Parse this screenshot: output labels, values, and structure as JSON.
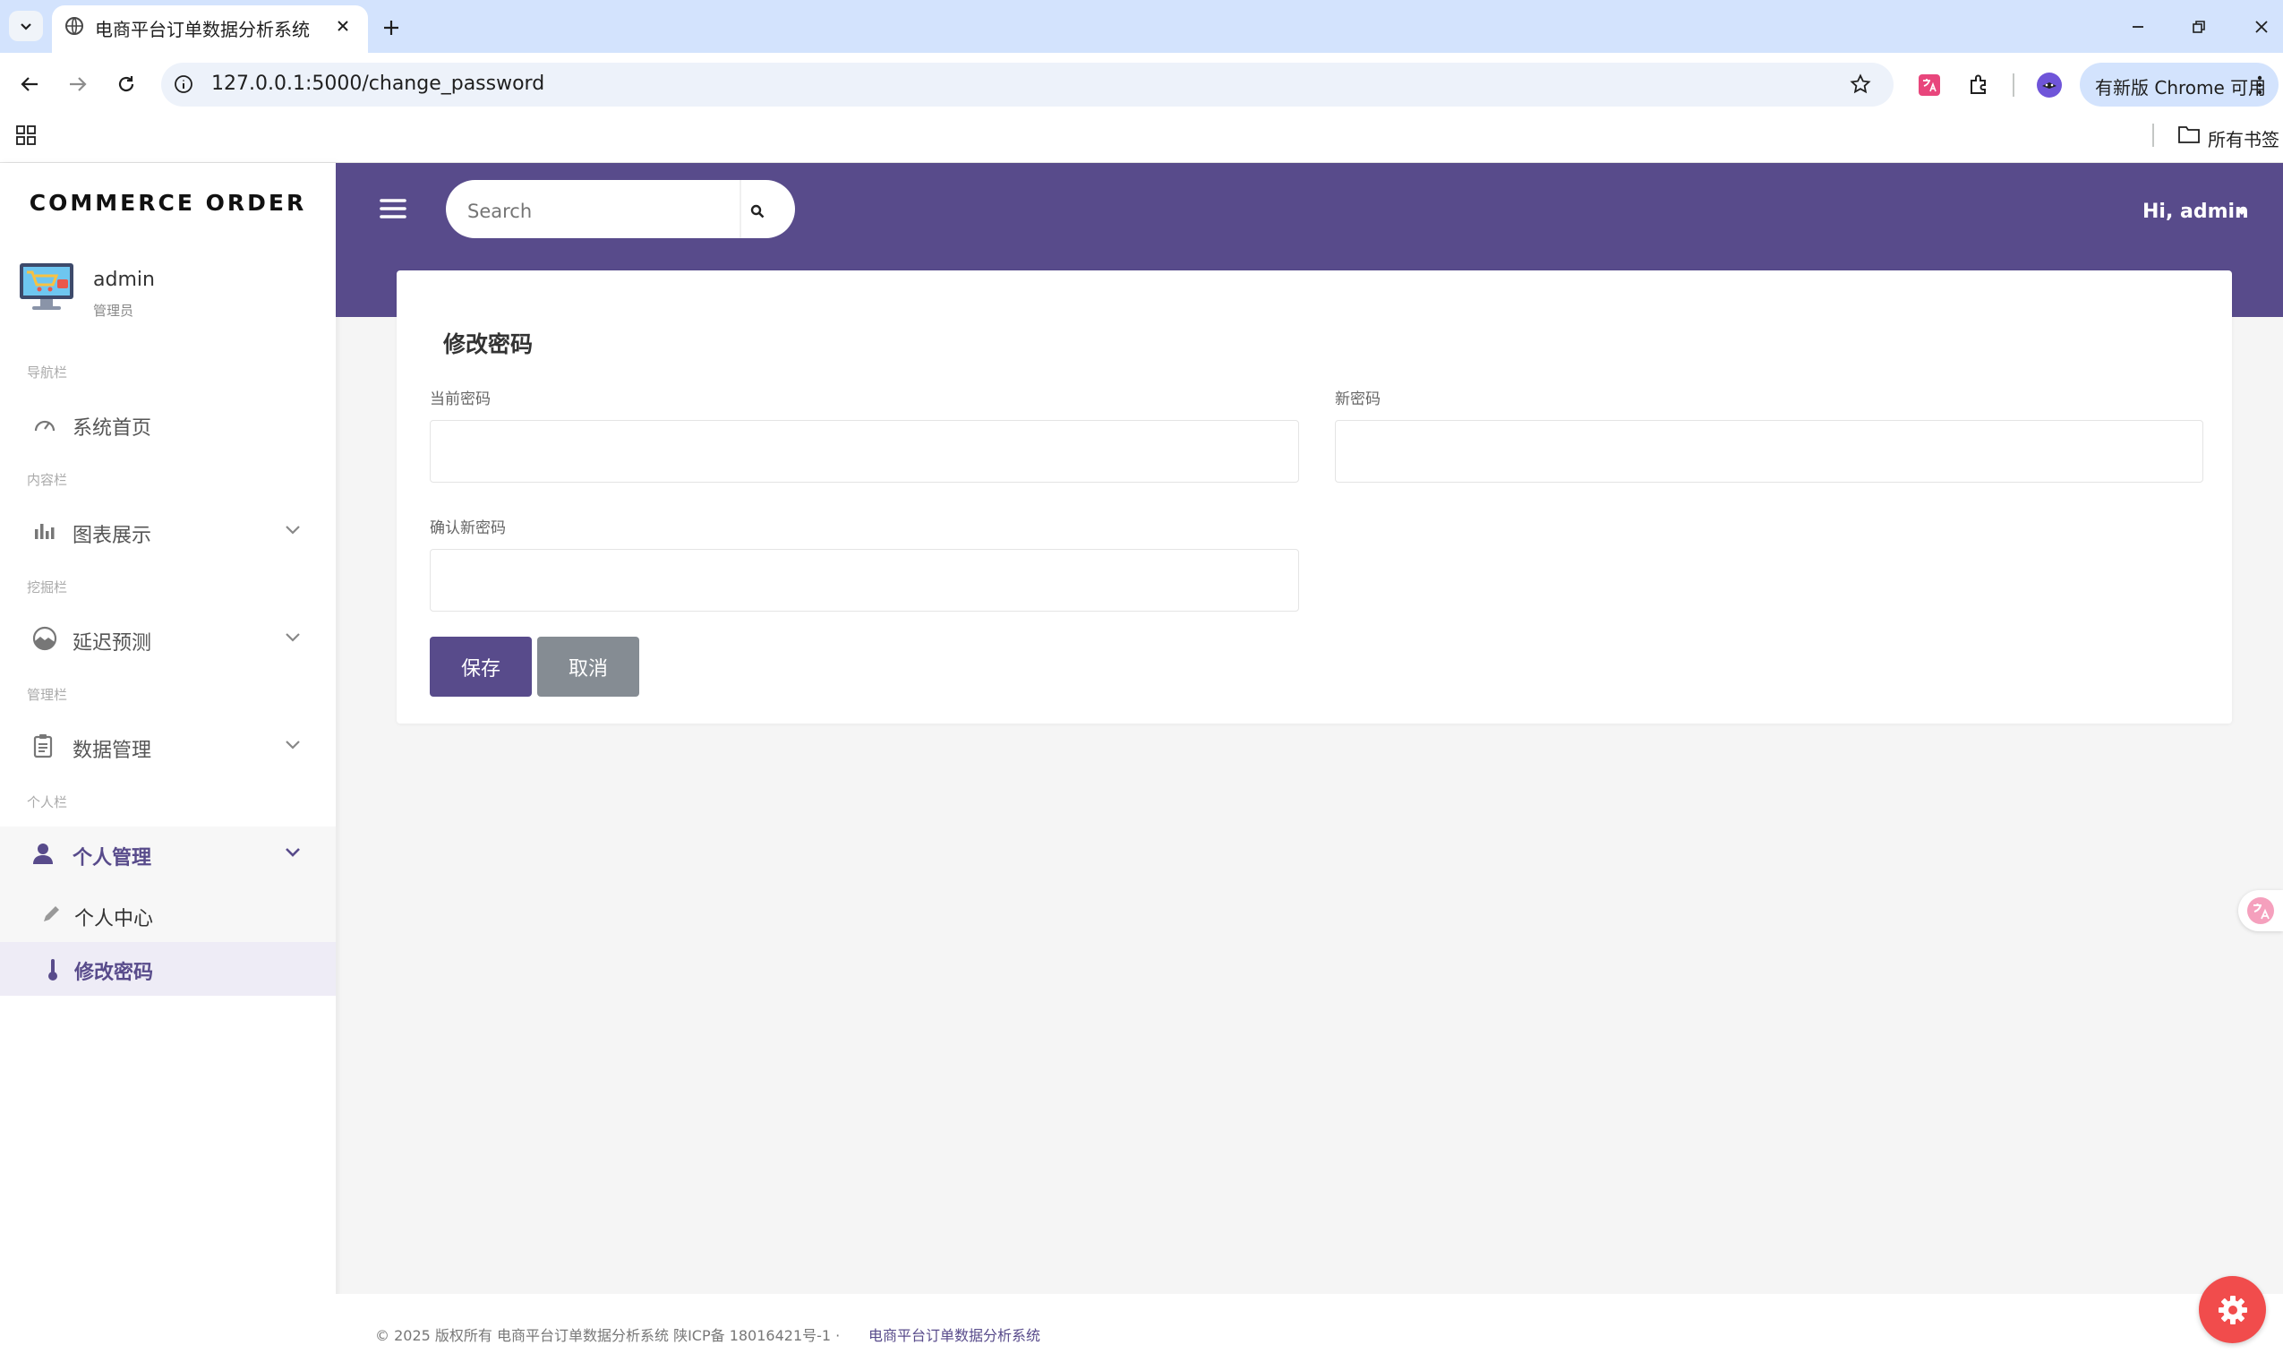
{
  "browser": {
    "tab_title": "电商平台订单数据分析系统",
    "url": "127.0.0.1:5000/change_password",
    "update_label": "有新版 Chrome 可用",
    "bookmarks_label": "所有书签"
  },
  "sidebar": {
    "brand": "COMMERCE ORDER",
    "user": {
      "name": "admin",
      "role": "管理员"
    },
    "sections": {
      "nav": "导航栏",
      "content": "内容栏",
      "mining": "挖掘栏",
      "manage": "管理栏",
      "personal": "个人栏"
    },
    "items": {
      "home": "系统首页",
      "charts": "图表展示",
      "delay": "延迟预测",
      "data": "数据管理",
      "personal": "个人管理",
      "center": "个人中心",
      "password": "修改密码"
    }
  },
  "header": {
    "search_placeholder": "Search",
    "greeting": "Hi, admin"
  },
  "form": {
    "title": "修改密码",
    "current_label": "当前密码",
    "new_label": "新密码",
    "confirm_label": "确认新密码",
    "save_label": "保存",
    "cancel_label": "取消"
  },
  "footer": {
    "copyright": "© 2025 版权所有 电商平台订单数据分析系统 陕ICP备 18016421号-1 ·",
    "link": "电商平台订单数据分析系统"
  },
  "colors": {
    "accent": "#584b8b",
    "fab": "#f14c4c",
    "cancel": "#858c93"
  }
}
